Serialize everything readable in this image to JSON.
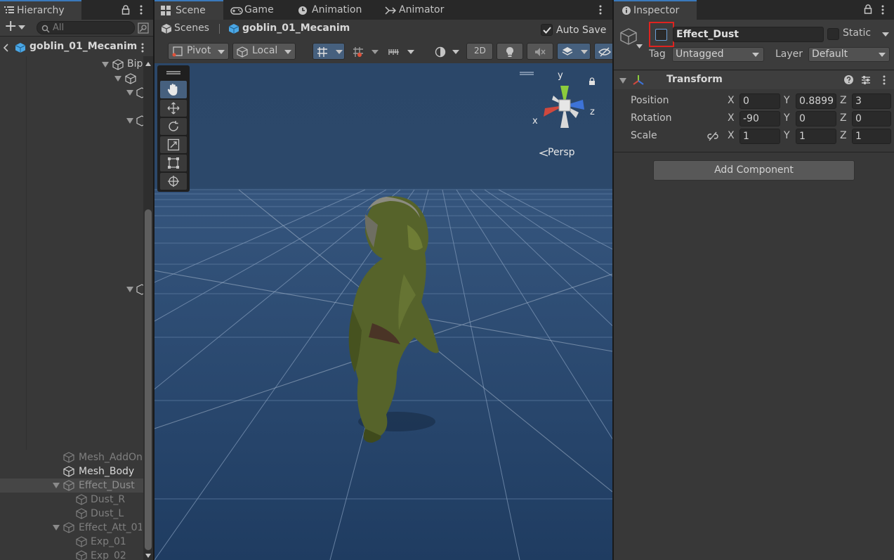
{
  "hierarchy": {
    "tab_label": "Hierarchy",
    "add_label": "+",
    "search_placeholder": "All",
    "breadcrumb": "goblin_01_Mecanim",
    "partial_label": "Bip",
    "items": [
      {
        "label": "Mesh_AddOn",
        "state": "disabled"
      },
      {
        "label": "Mesh_Body",
        "state": "normal"
      },
      {
        "label": "Effect_Dust",
        "state": "selected"
      },
      {
        "label": "Dust_R",
        "state": "disabled"
      },
      {
        "label": "Dust_L",
        "state": "disabled"
      },
      {
        "label": "Effect_Att_01",
        "state": "disabled"
      },
      {
        "label": "Exp_01",
        "state": "disabled"
      },
      {
        "label": "Exp_02",
        "state": "disabled"
      }
    ]
  },
  "tabs": {
    "scene": "Scene",
    "game": "Game",
    "animation": "Animation",
    "animator": "Animator"
  },
  "scene": {
    "breadcrumb_root": "Scenes",
    "breadcrumb_current": "goblin_01_Mecanim",
    "auto_save_label": "Auto Save",
    "auto_save_checked": true,
    "pivot_label": "Pivot",
    "local_label": "Local",
    "mode_2d_label": "2D",
    "persp_label": "Persp",
    "gizmo_axes": {
      "x": "x",
      "y": "y",
      "z": "z"
    }
  },
  "inspector": {
    "tab_label": "Inspector",
    "object_name": "Effect_Dust",
    "active_checked": false,
    "static_label": "Static",
    "tag_label": "Tag",
    "tag_value": "Untagged",
    "layer_label": "Layer",
    "layer_value": "Default",
    "transform": {
      "title": "Transform",
      "position_label": "Position",
      "rotation_label": "Rotation",
      "scale_label": "Scale",
      "axis_x": "X",
      "axis_y": "Y",
      "axis_z": "Z",
      "position": {
        "x": "0",
        "y": "0.8899",
        "z": "3"
      },
      "rotation": {
        "x": "-90",
        "y": "0",
        "z": "0"
      },
      "scale": {
        "x": "1",
        "y": "1",
        "z": "1"
      }
    },
    "add_component_label": "Add Component"
  },
  "colors": {
    "accent": "#3a79bb",
    "highlight_box": "#e0231f",
    "scene_sky": "#2a4568",
    "scene_ground": "#1f3d63",
    "gizmo_x": "#d0483d",
    "gizmo_y": "#8ccc3c",
    "gizmo_z": "#3d73d8"
  }
}
